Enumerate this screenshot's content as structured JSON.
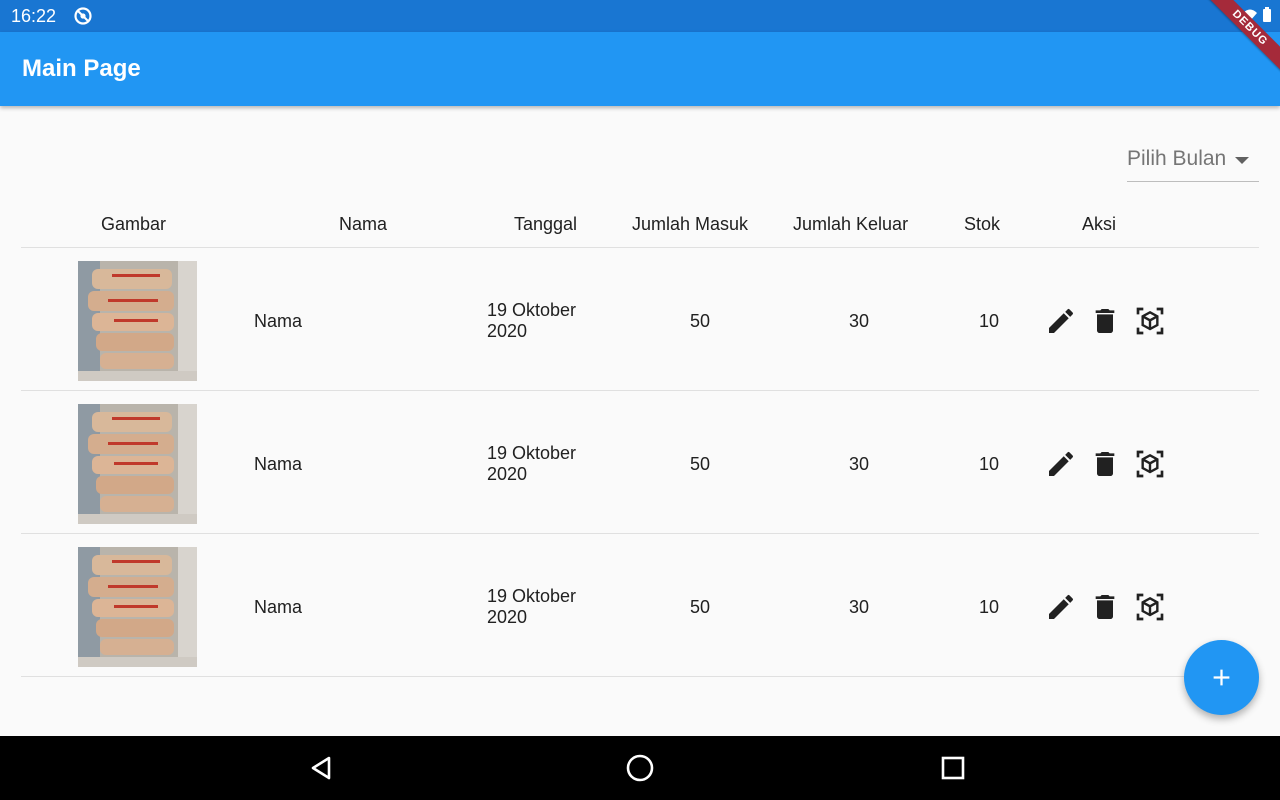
{
  "status_bar": {
    "time": "16:22"
  },
  "app_bar": {
    "title": "Main Page"
  },
  "debug_banner": "DEBUG",
  "filter": {
    "month_placeholder": "Pilih Bulan"
  },
  "table": {
    "columns": [
      "Gambar",
      "Nama",
      "Tanggal",
      "Jumlah Masuk",
      "Jumlah Keluar",
      "Stok",
      "Aksi"
    ],
    "rows": [
      {
        "name": "Nama",
        "date_line1": "19 Oktober",
        "date_line2": "2020",
        "masuk": "50",
        "keluar": "30",
        "stok": "10"
      },
      {
        "name": "Nama",
        "date_line1": "19 Oktober",
        "date_line2": "2020",
        "masuk": "50",
        "keluar": "30",
        "stok": "10"
      },
      {
        "name": "Nama",
        "date_line1": "19 Oktober",
        "date_line2": "2020",
        "masuk": "50",
        "keluar": "30",
        "stok": "10"
      }
    ],
    "row_actions": [
      "edit-icon",
      "delete-icon",
      "ar-cube-icon"
    ]
  },
  "fab": {
    "icon": "add-icon"
  },
  "nav_bar": {
    "icons": [
      "back-icon",
      "home-icon",
      "recents-icon"
    ]
  },
  "colors": {
    "primary": "#2196f3",
    "status_bar": "#1976d2",
    "background": "#fafafa",
    "nav_bar": "#000000"
  }
}
